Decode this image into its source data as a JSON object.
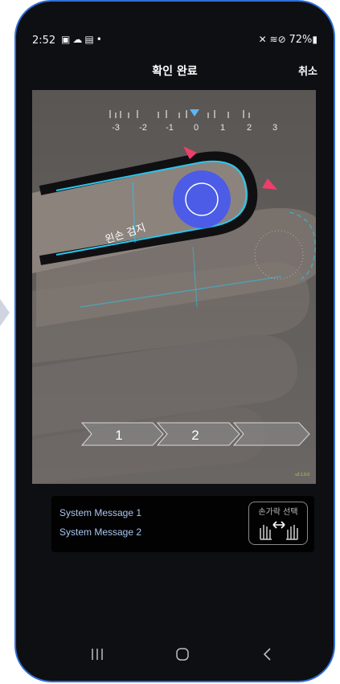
{
  "status_bar": {
    "time": "2:52",
    "left_icons": [
      "image-icon",
      "cloud-icon",
      "calendar-icon",
      "dot-icon"
    ],
    "right_icons": [
      "mute-icon",
      "wifi-icon",
      "blocked-icon",
      "battery-icon"
    ],
    "battery": "72%"
  },
  "header": {
    "title": "확인 완료",
    "cancel_label": "취소"
  },
  "camera": {
    "scale_ticks": [
      "-3",
      "-2",
      "-1",
      "0",
      "1",
      "2",
      "3"
    ],
    "scale_indicator_value": 0,
    "detect_label": "왼손 검지",
    "steps": [
      "1",
      "2",
      ""
    ],
    "version": "v2.1.0.0"
  },
  "messages": {
    "line1": "System Message 1",
    "line2": "System Message 2",
    "finger_select_label": "손가락 선택"
  },
  "nav": {
    "icons": [
      "recent-apps-icon",
      "home-icon",
      "back-icon"
    ]
  },
  "colors": {
    "accent_cyan": "#29c7ee",
    "marker_pink": "#ef3e6a",
    "sensor_blue": "#4c5ce6",
    "frame_blue": "#2f6fd8"
  }
}
